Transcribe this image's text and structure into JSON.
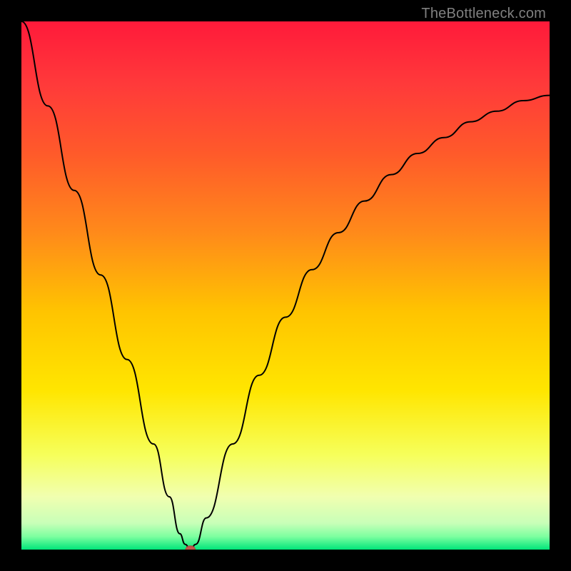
{
  "watermark": "TheBottleneck.com",
  "chart_data": {
    "type": "line",
    "title": "",
    "xlabel": "",
    "ylabel": "",
    "xlim": [
      0,
      100
    ],
    "ylim": [
      0,
      100
    ],
    "series": [
      {
        "name": "bottleneck-curve",
        "x": [
          0,
          5,
          10,
          15,
          20,
          25,
          28,
          30,
          31,
          32,
          33,
          35,
          40,
          45,
          50,
          55,
          60,
          65,
          70,
          75,
          80,
          85,
          90,
          95,
          100
        ],
        "y": [
          100,
          84,
          68,
          52,
          36,
          20,
          10,
          3,
          1,
          0,
          1,
          6,
          20,
          33,
          44,
          53,
          60,
          66,
          71,
          75,
          78,
          81,
          83,
          85,
          86
        ]
      }
    ],
    "marker": {
      "x": 32,
      "y": 0
    },
    "background_gradient": {
      "stops": [
        {
          "offset": 0.0,
          "color": "#ff1a3a"
        },
        {
          "offset": 0.12,
          "color": "#ff3a3a"
        },
        {
          "offset": 0.25,
          "color": "#ff5a2a"
        },
        {
          "offset": 0.4,
          "color": "#ff8a1a"
        },
        {
          "offset": 0.55,
          "color": "#ffc400"
        },
        {
          "offset": 0.7,
          "color": "#ffe600"
        },
        {
          "offset": 0.82,
          "color": "#f6ff5a"
        },
        {
          "offset": 0.9,
          "color": "#f1ffb0"
        },
        {
          "offset": 0.95,
          "color": "#c8ffb8"
        },
        {
          "offset": 0.975,
          "color": "#7effa0"
        },
        {
          "offset": 1.0,
          "color": "#00e57a"
        }
      ]
    },
    "colors": {
      "curve": "#000000",
      "marker_fill": "#c0554a",
      "marker_stroke": "#b04a40"
    }
  }
}
